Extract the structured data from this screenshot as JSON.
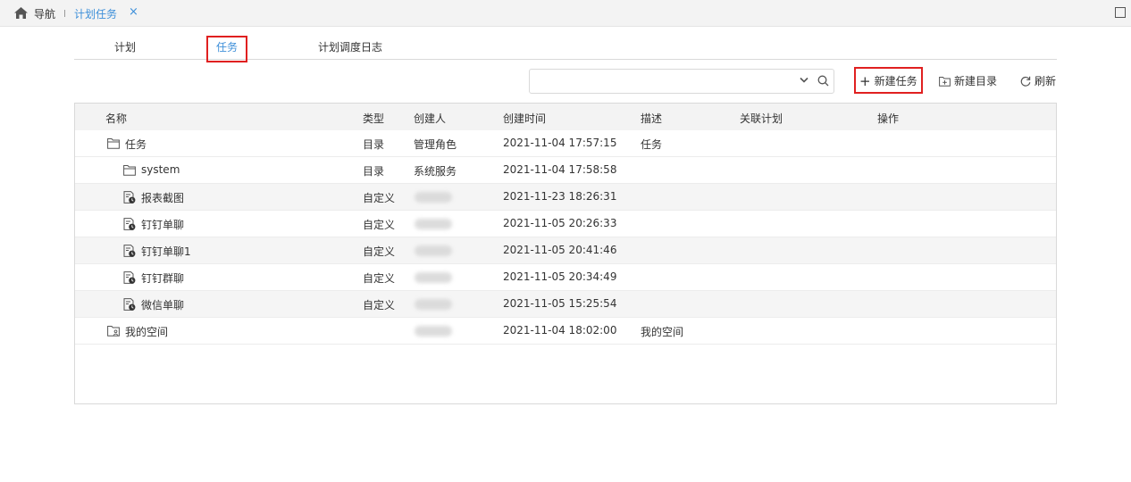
{
  "topbar": {
    "nav_label": "导航",
    "tab_label": "计划任务",
    "close_glyph": "×"
  },
  "subtabs": [
    {
      "label": "计划",
      "active": false
    },
    {
      "label": "任务",
      "active": true
    },
    {
      "label": "计划调度日志",
      "active": false
    }
  ],
  "search": {
    "value": "",
    "placeholder": ""
  },
  "toolbar": {
    "new_task_glyph": "+",
    "new_task_label": "新建任务",
    "new_dir_label": "新建目录",
    "refresh_label": "刷新"
  },
  "table": {
    "headers": {
      "name": "名称",
      "type": "类型",
      "creator": "创建人",
      "created": "创建时间",
      "desc": "描述",
      "plan": "关联计划",
      "ops": "操作"
    },
    "rows": [
      {
        "name": "任务",
        "icon": "folder-icon",
        "type": "目录",
        "creator": "管理角色",
        "created": "2021-11-04 17:57:15",
        "desc": "任务"
      },
      {
        "name": "system",
        "icon": "folder-icon",
        "type": "目录",
        "creator": "系统服务",
        "created": "2021-11-04 17:58:58",
        "desc": ""
      },
      {
        "name": "报表截图",
        "icon": "task-file-icon",
        "type": "自定义",
        "creator": "",
        "created": "2021-11-23 18:26:31",
        "desc": ""
      },
      {
        "name": "钉钉单聊",
        "icon": "task-file-icon",
        "type": "自定义",
        "creator": "",
        "created": "2021-11-05 20:26:33",
        "desc": ""
      },
      {
        "name": "钉钉单聊1",
        "icon": "task-file-icon",
        "type": "自定义",
        "creator": "",
        "created": "2021-11-05 20:41:46",
        "desc": ""
      },
      {
        "name": "钉钉群聊",
        "icon": "task-file-icon",
        "type": "自定义",
        "creator": "",
        "created": "2021-11-05 20:34:49",
        "desc": ""
      },
      {
        "name": "微信单聊",
        "icon": "task-file-icon",
        "type": "自定义",
        "creator": "",
        "created": "2021-11-05 15:25:54",
        "desc": ""
      },
      {
        "name": "我的空间",
        "icon": "user-folder-icon",
        "type": "",
        "creator": "",
        "created": "2021-11-04 18:02:00",
        "desc": "我的空间"
      }
    ]
  },
  "colors": {
    "accent": "#3d8fd9",
    "highlight": "#e02020",
    "header_bg": "#f3f3f3"
  }
}
